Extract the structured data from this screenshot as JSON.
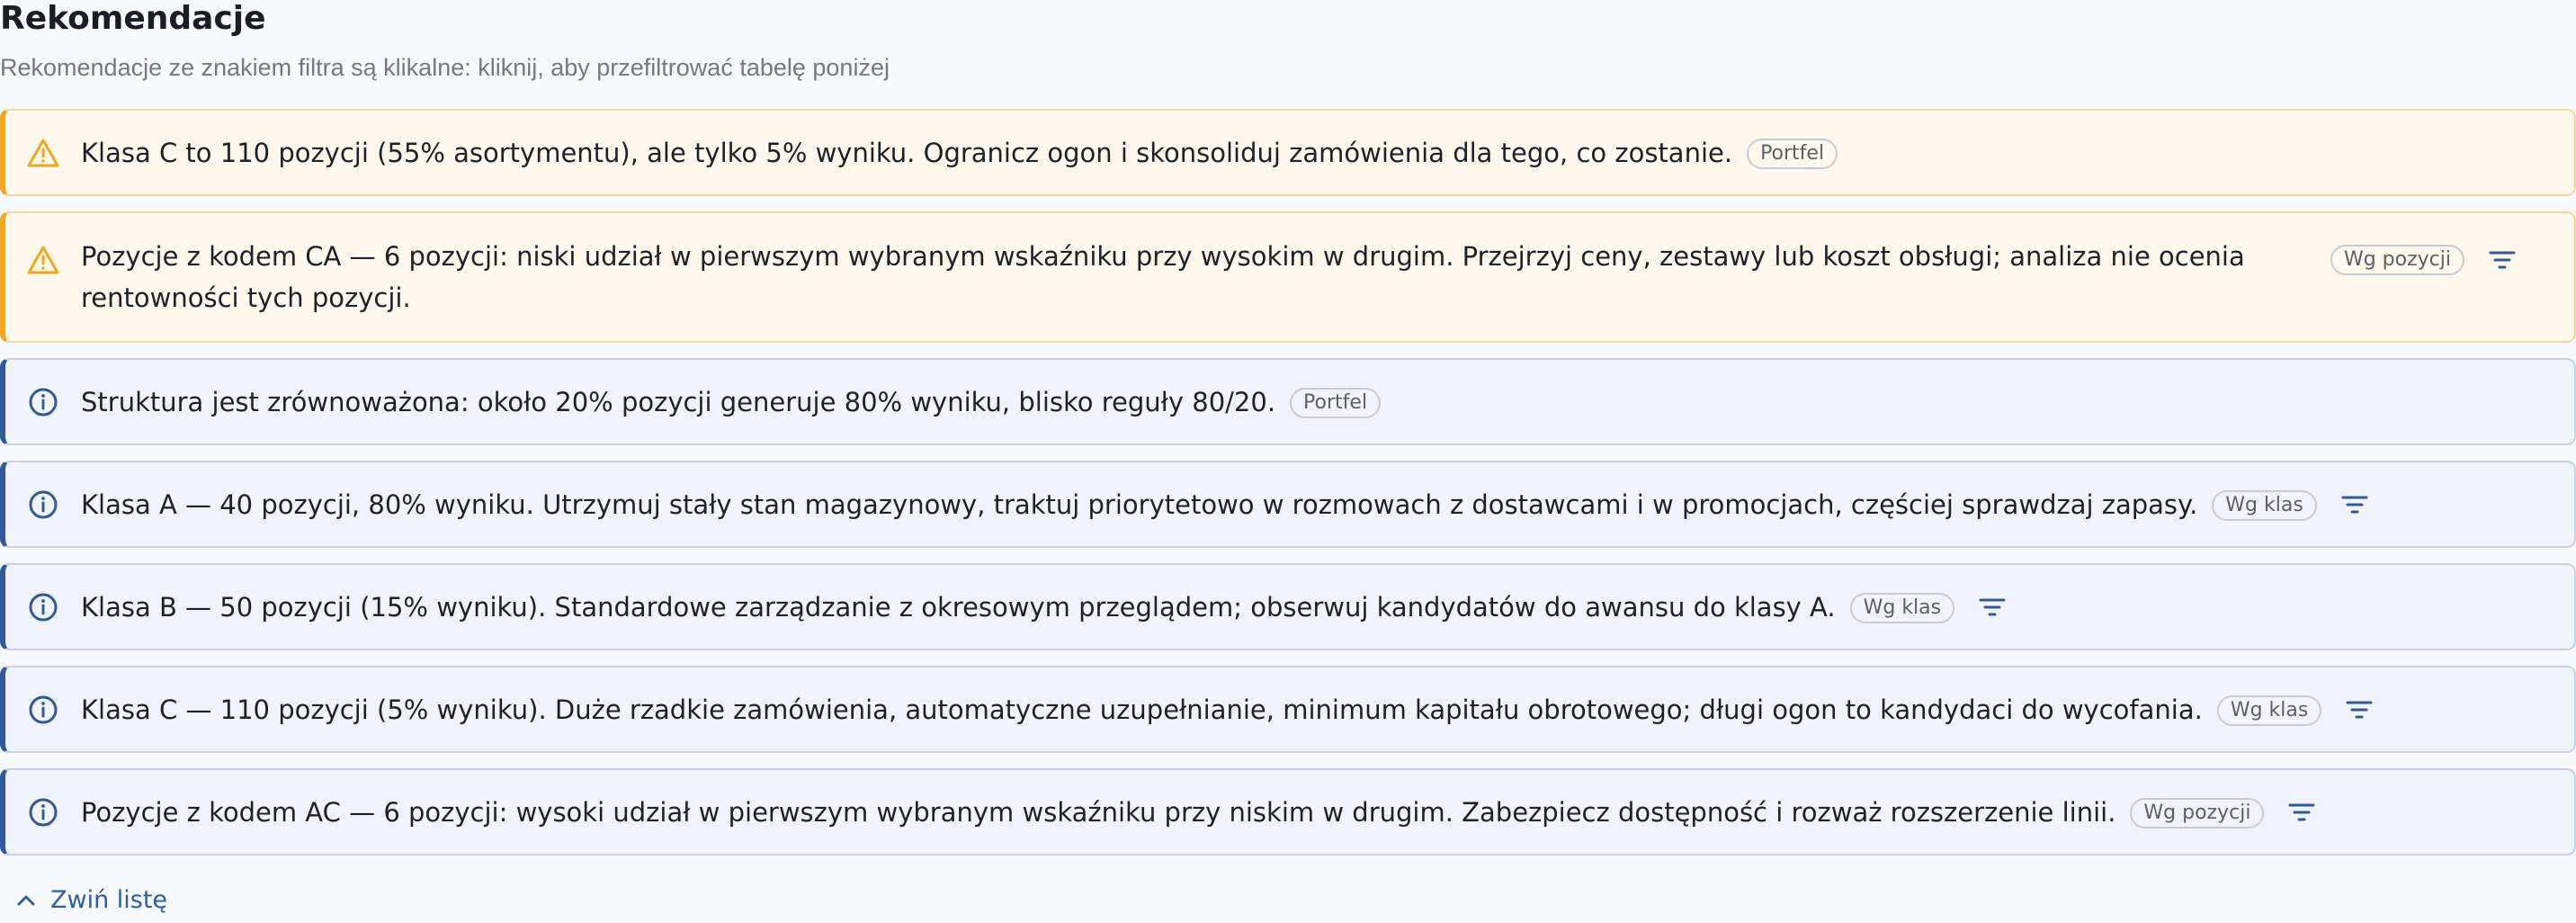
{
  "header": {
    "title": "Rekomendacje",
    "subtitle": "Rekomendacje ze znakiem filtra są klikalne: kliknij, aby przefiltrować tabelę poniżej"
  },
  "colors": {
    "warning_accent": "#f2a81d",
    "warning_bg": "#fff8ec",
    "info_accent": "#31589a",
    "info_bg": "#f0f4fa",
    "link": "#2f5d9e"
  },
  "recommendations": [
    {
      "severity": "warning",
      "icon": "warning-triangle-icon",
      "text": "Klasa C to 110 pozycji (55% asortymentu), ale tylko 5% wyniku. Ogranicz ogon i skonsoliduj zamówienia dla tego, co zostanie.",
      "tag": "Portfel",
      "filterable": false
    },
    {
      "severity": "warning",
      "icon": "warning-triangle-icon",
      "text": "Pozycje z kodem CA — 6 pozycji: niski udział w pierwszym wybranym wskaźniku przy wysokim w drugim. Przejrzyj ceny, zestawy lub koszt obsługi; analiza nie ocenia rentowności tych pozycji.",
      "tag": "Wg pozycji",
      "filterable": true
    },
    {
      "severity": "info",
      "icon": "info-circle-icon",
      "text": "Struktura jest zrównoważona: około 20% pozycji generuje 80% wyniku, blisko reguły 80/20.",
      "tag": "Portfel",
      "filterable": false
    },
    {
      "severity": "info",
      "icon": "info-circle-icon",
      "text": "Klasa A — 40 pozycji, 80% wyniku. Utrzymuj stały stan magazynowy, traktuj priorytetowo w rozmowach z dostawcami i w promocjach, częściej sprawdzaj zapasy.",
      "tag": "Wg klas",
      "filterable": true
    },
    {
      "severity": "info",
      "icon": "info-circle-icon",
      "text": "Klasa B — 50 pozycji (15% wyniku). Standardowe zarządzanie z okresowym przeglądem; obserwuj kandydatów do awansu do klasy A.",
      "tag": "Wg klas",
      "filterable": true
    },
    {
      "severity": "info",
      "icon": "info-circle-icon",
      "text": "Klasa C — 110 pozycji (5% wyniku). Duże rzadkie zamówienia, automatyczne uzupełnianie, minimum kapitału obrotowego; długi ogon to kandydaci do wycofania.",
      "tag": "Wg klas",
      "filterable": true
    },
    {
      "severity": "info",
      "icon": "info-circle-icon",
      "text": "Pozycje z kodem AC — 6 pozycji: wysoki udział w pierwszym wybranym wskaźniku przy niskim w drugim. Zabezpiecz dostępność i rozważ rozszerzenie linii.",
      "tag": "Wg pozycji",
      "filterable": true
    }
  ],
  "footer": {
    "collapse_label": "Zwiń listę",
    "collapse_icon": "chevron-up-icon"
  }
}
